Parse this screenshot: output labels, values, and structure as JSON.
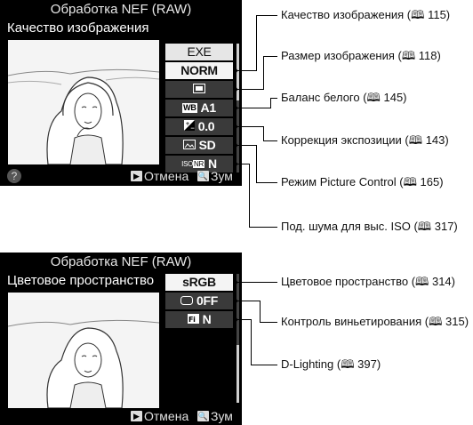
{
  "screen1": {
    "title": "Обработка NEF (RAW)",
    "heading": "Качество изображения",
    "menu": [
      {
        "label": "EXE",
        "icon": "",
        "state": "header"
      },
      {
        "label": "NORM",
        "icon": "",
        "state": "selected"
      },
      {
        "label": "",
        "icon": "image-size-icon",
        "state": "normal"
      },
      {
        "label": "A1",
        "icon": "white-balance-icon",
        "state": "normal"
      },
      {
        "label": "0.0",
        "icon": "exposure-comp-icon",
        "state": "normal"
      },
      {
        "label": "SD",
        "icon": "picture-control-icon",
        "state": "normal"
      },
      {
        "label": "N",
        "icon": "iso-nr-icon",
        "state": "normal"
      }
    ],
    "bottom": {
      "help": "?",
      "cancel": "Отмена",
      "zoom": "Зум"
    }
  },
  "screen2": {
    "title": "Обработка NEF (RAW)",
    "heading": "Цветовое пространство",
    "menu": [
      {
        "label": "sRGB",
        "icon": "",
        "state": "selected"
      },
      {
        "label": "0FF",
        "icon": "vignette-icon",
        "state": "normal"
      },
      {
        "label": "N",
        "icon": "d-lighting-icon",
        "state": "normal"
      }
    ],
    "bottom": {
      "cancel": "Отмена",
      "zoom": "Зум"
    }
  },
  "callouts": [
    {
      "text": "Качество изображения (🕮 115)"
    },
    {
      "text": "Размер изображения (🕮 118)"
    },
    {
      "text": "Баланс белого (🕮 145)"
    },
    {
      "text": "Коррекция экспозиции (🕮 143)"
    },
    {
      "text": "Режим Picture Control (🕮 165)"
    },
    {
      "text": "Под. шума для выс. ISO (🕮 317)"
    },
    {
      "text": "Цветовое пространство (🕮 314)"
    },
    {
      "text": "Контроль виньетирования (🕮 315)"
    },
    {
      "text": "D-Lighting (🕮 397)"
    }
  ]
}
